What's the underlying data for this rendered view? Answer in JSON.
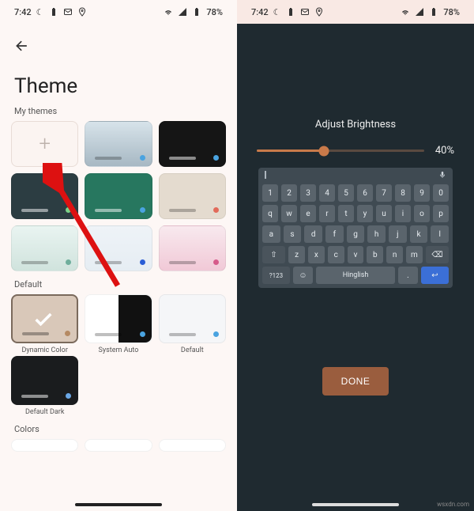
{
  "status": {
    "time": "7:42",
    "moon": "☾",
    "battery_pct": "78%"
  },
  "left": {
    "title": "Theme",
    "sections": {
      "my_themes": "My themes",
      "default": "Default",
      "colors": "Colors"
    },
    "defaults": {
      "dynamic": "Dynamic Color",
      "system_auto": "System Auto",
      "default": "Default",
      "default_dark": "Default Dark"
    }
  },
  "right": {
    "brightness_label": "Adjust Brightness",
    "brightness_value": "40%",
    "done": "DONE",
    "keyboard": {
      "row1": [
        "1",
        "2",
        "3",
        "4",
        "5",
        "6",
        "7",
        "8",
        "9",
        "0"
      ],
      "row2": [
        "q",
        "w",
        "e",
        "r",
        "t",
        "y",
        "u",
        "i",
        "o",
        "p"
      ],
      "row3": [
        "a",
        "s",
        "d",
        "f",
        "g",
        "h",
        "j",
        "k",
        "l"
      ],
      "row4_mid": [
        "z",
        "x",
        "c",
        "v",
        "b",
        "n",
        "m"
      ],
      "shift": "⇧",
      "backspace": "⌫",
      "sym": "?123",
      "emoji": "☺",
      "space": "Hinglish",
      "period": ".",
      "enter": "↩"
    }
  },
  "watermark": "wsxdn.com"
}
